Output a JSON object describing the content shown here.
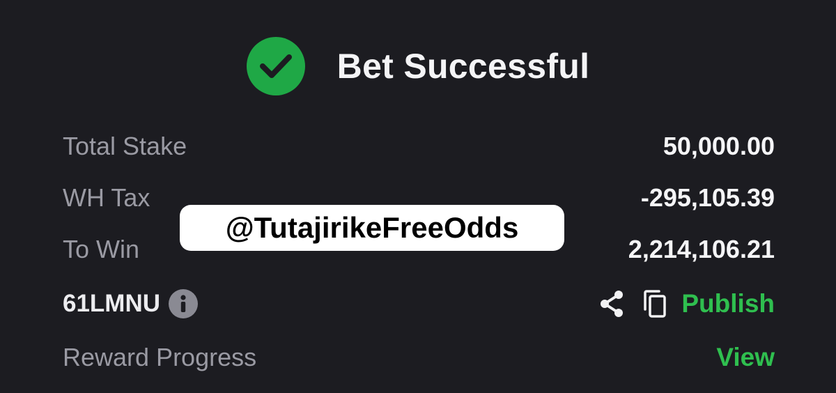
{
  "header": {
    "title": "Bet Successful",
    "icon": "check-circle-icon",
    "icon_color": "#1fa846"
  },
  "summary": {
    "rows": [
      {
        "label": "Total Stake",
        "value": "50,000.00"
      },
      {
        "label": "WH Tax",
        "value": "-295,105.39"
      },
      {
        "label": "To Win",
        "value": "2,214,106.21"
      }
    ]
  },
  "booking": {
    "code": "61LMNU",
    "info_icon": "info-icon",
    "share_icon": "share-icon",
    "copy_icon": "copy-icon",
    "publish_label": "Publish"
  },
  "reward": {
    "label": "Reward Progress",
    "view_label": "View"
  },
  "watermark": {
    "text": "@TutajirikeFreeOdds"
  },
  "colors": {
    "background": "#1c1c21",
    "accent_green": "#2fbf4f",
    "label_gray": "#9a9aa3"
  }
}
